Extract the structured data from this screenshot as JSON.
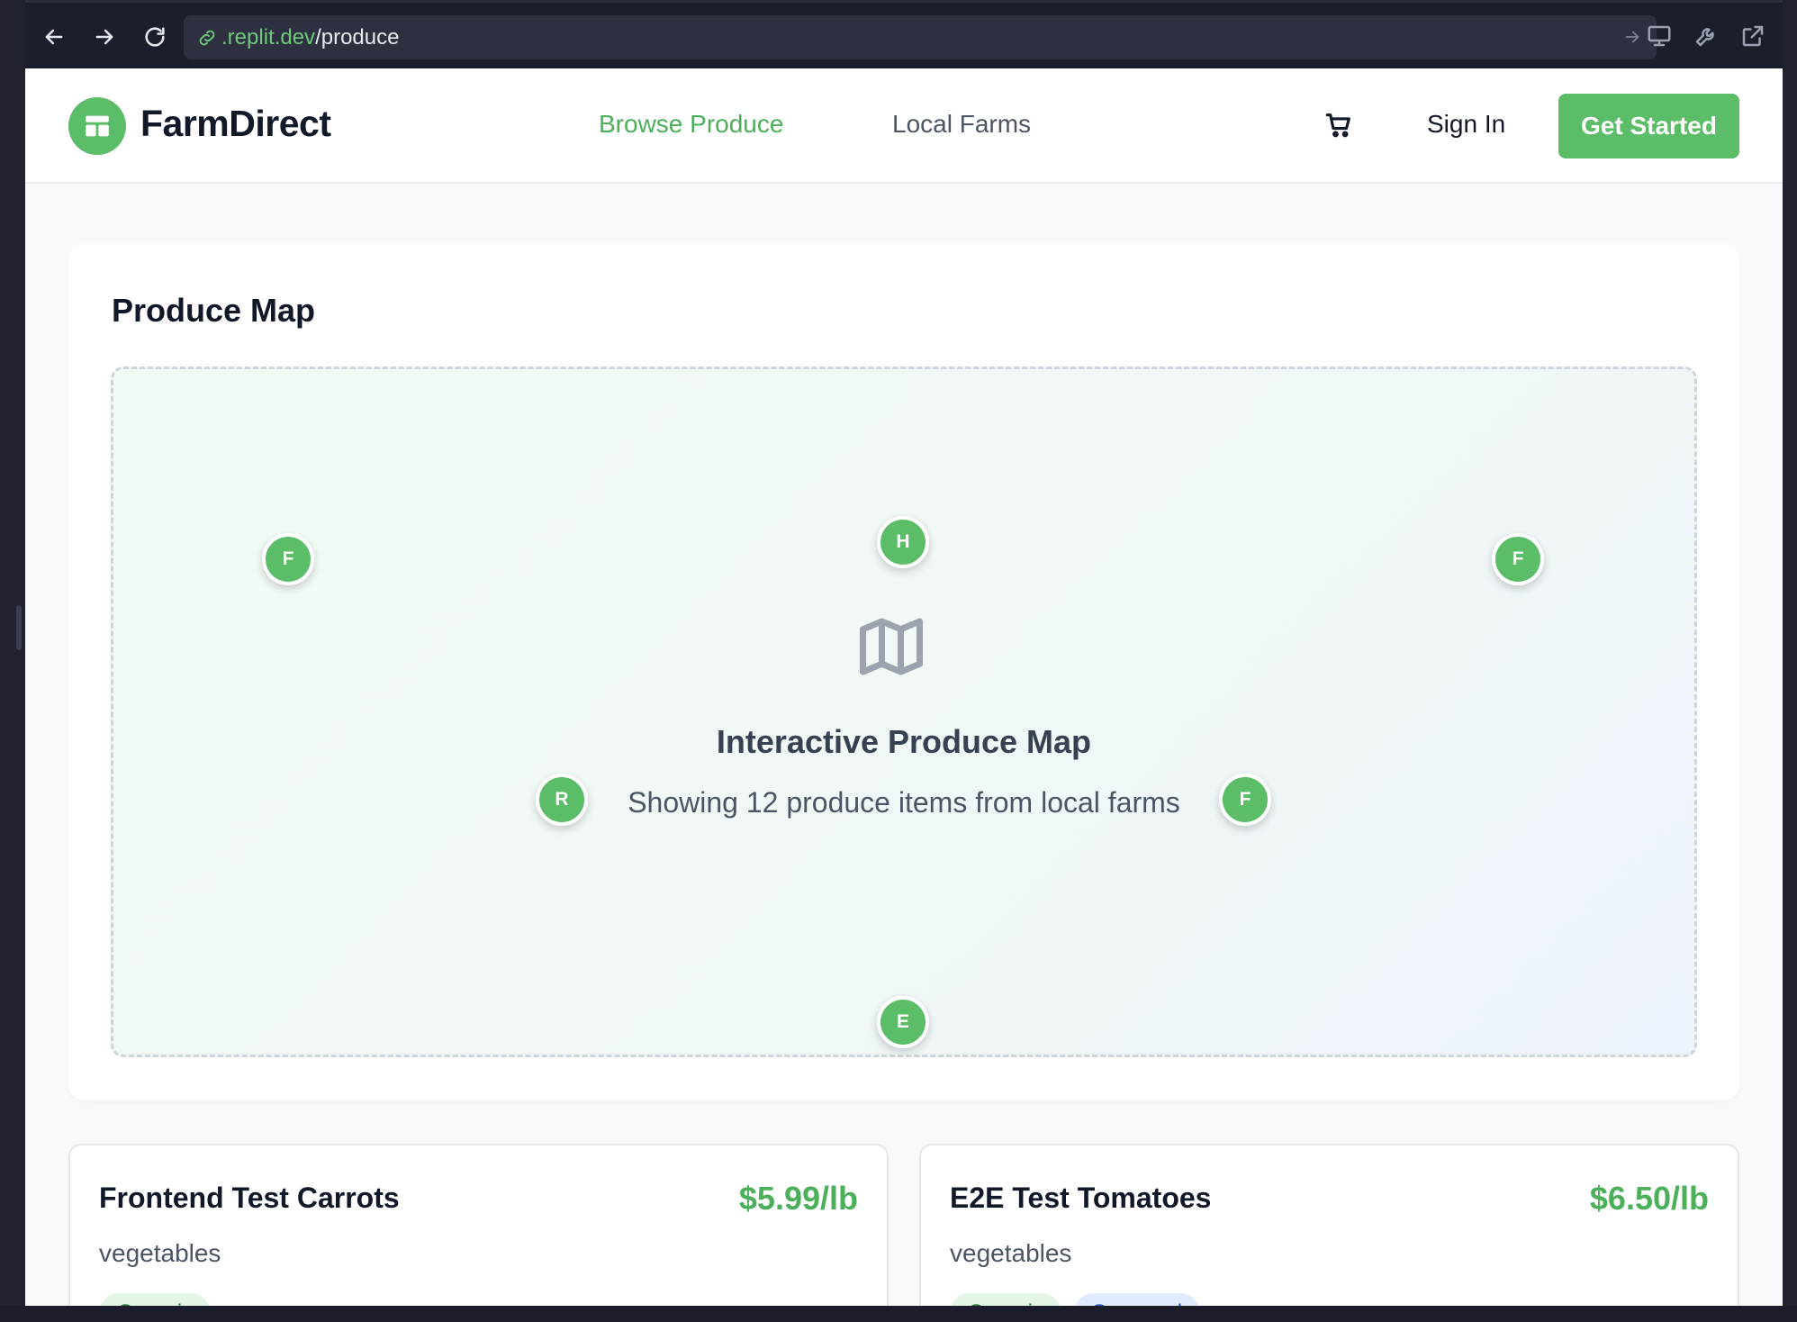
{
  "browser": {
    "url_domain": ".replit.dev",
    "url_path": "/produce"
  },
  "header": {
    "brand": "FarmDirect",
    "nav": [
      {
        "label": "Browse Produce",
        "active": true
      },
      {
        "label": "Local Farms",
        "active": false
      }
    ],
    "sign_in": "Sign In",
    "cta": "Get Started"
  },
  "map": {
    "title": "Produce Map",
    "heading": "Interactive Produce Map",
    "subtitle": "Showing 12 produce items from local farms",
    "markers": [
      {
        "letter": "F"
      },
      {
        "letter": "H"
      },
      {
        "letter": "F"
      },
      {
        "letter": "R"
      },
      {
        "letter": "F"
      },
      {
        "letter": "E"
      }
    ]
  },
  "products": [
    {
      "name": "Frontend Test Carrots",
      "price": "$5.99/lb",
      "category": "vegetables",
      "tags": [
        "Organic"
      ]
    },
    {
      "name": "E2E Test Tomatoes",
      "price": "$6.50/lb",
      "category": "vegetables",
      "tags": [
        "Organic",
        "Seasonal"
      ]
    }
  ],
  "colors": {
    "brand_green": "#5bbd68",
    "browser_bg": "#1b1e2c"
  }
}
